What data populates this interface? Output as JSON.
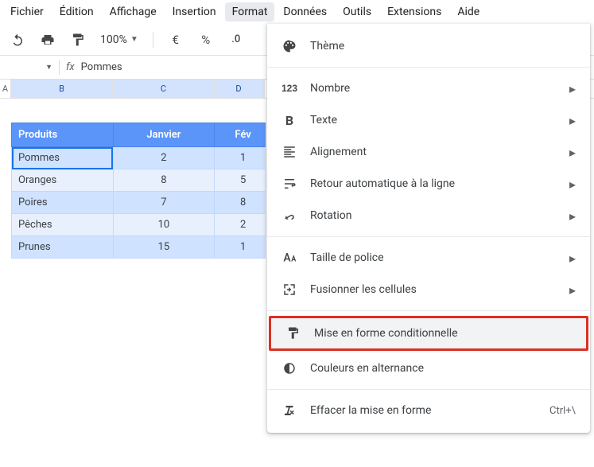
{
  "menubar": {
    "file": "Fichier",
    "edit": "Édition",
    "view": "Affichage",
    "insert": "Insertion",
    "format": "Format",
    "data": "Données",
    "tools": "Outils",
    "extensions": "Extensions",
    "help": "Aide"
  },
  "toolbar": {
    "zoom": "100%",
    "currency": "€",
    "percent": "%",
    "decimals": ".0"
  },
  "fxbar": {
    "fx": "fx",
    "value": "Pommes"
  },
  "colheads": {
    "a": "A",
    "b": "B",
    "c": "C",
    "d": "D"
  },
  "table": {
    "headers": {
      "produits": "Produits",
      "janvier": "Janvier",
      "fevrier": "Fév"
    },
    "rows": [
      {
        "p": "Pommes",
        "j": "2",
        "f": "1"
      },
      {
        "p": "Oranges",
        "j": "8",
        "f": "5"
      },
      {
        "p": "Poires",
        "j": "7",
        "f": "8"
      },
      {
        "p": "Pêches",
        "j": "10",
        "f": "2"
      },
      {
        "p": "Prunes",
        "j": "15",
        "f": "1"
      }
    ]
  },
  "dropdown": {
    "theme": "Thème",
    "number": "Nombre",
    "text": "Texte",
    "align": "Alignement",
    "wrap": "Retour automatique à la ligne",
    "rotation": "Rotation",
    "fontsize": "Taille de police",
    "merge": "Fusionner les cellules",
    "condformat": "Mise en forme conditionnelle",
    "altcolor": "Couleurs en alternance",
    "clear": "Effacer la mise en forme",
    "clear_shortcut": "Ctrl+\\"
  }
}
